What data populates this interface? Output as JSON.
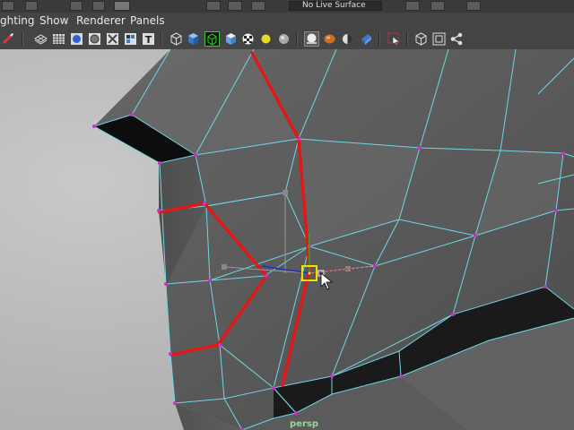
{
  "app": {
    "top_field_text": "No Live Surface"
  },
  "menu": {
    "lighting": "Lighting",
    "show": "Show",
    "renderer": "Renderer",
    "panels": "Panels"
  },
  "toolbar": {
    "icons": [
      "select-camera-icon",
      "wireframe-icon",
      "smooth-shade-icon",
      "default-material-icon",
      "textured-icon",
      "xray-icon",
      "isolate-icon",
      "text-icon",
      "cube-wire-icon",
      "cube-shaded-icon",
      "cube-selected-icon",
      "cube-textured-icon",
      "checker-icon",
      "light-bulb-icon",
      "sphere-gray-icon",
      "sphere-white-icon",
      "sphere-orange-icon",
      "half-sphere-icon",
      "blue-cube-icon",
      "select-arrow-icon",
      "cube-outline-icon",
      "frame-icon",
      "share-node-icon"
    ]
  },
  "viewport": {
    "camera_label": "persp",
    "colors": {
      "edge": "#6fd6e6",
      "selected_edge": "#e01818",
      "vertex": "#d22bd2",
      "manip_center": "#f0e000"
    }
  }
}
